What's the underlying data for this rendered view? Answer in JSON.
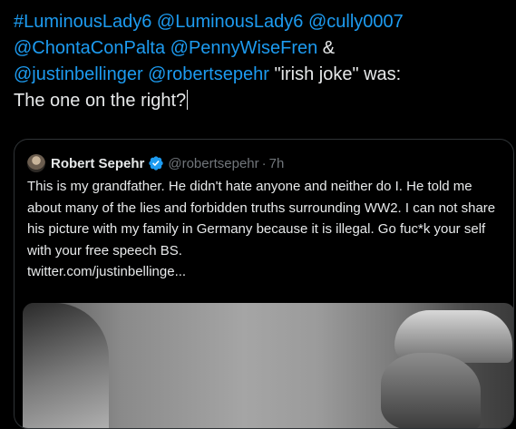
{
  "compose": {
    "mentions": [
      "#LuminousLady6",
      "@LuminousLady6",
      "@cully0007",
      "@ChontaConPalta",
      "@PennyWiseFren",
      "&",
      "@justinbellinger",
      "@robertsepehr"
    ],
    "after_mentions": "\"irish joke\" was:",
    "second_line": "The one on the right?"
  },
  "quote": {
    "author_name": "Robert Sepehr",
    "handle": "@robertsepehr",
    "separator": "·",
    "time": "7h",
    "text": "This is my grandfather. He didn't hate anyone and neither do I. He told me about many of the lies and forbidden truths surrounding WW2. I can not share his picture with my family in Germany because it is illegal. Go fuc*k your self with your free speech BS.",
    "link": "twitter.com/justinbellinge..."
  },
  "icons": {
    "avatar": "author-avatar",
    "verified": "verified-badge-icon"
  },
  "colors": {
    "background": "#000000",
    "text": "#e7e9ea",
    "accent": "#1d9bf0",
    "muted": "#71767b",
    "border": "#2f3336"
  }
}
